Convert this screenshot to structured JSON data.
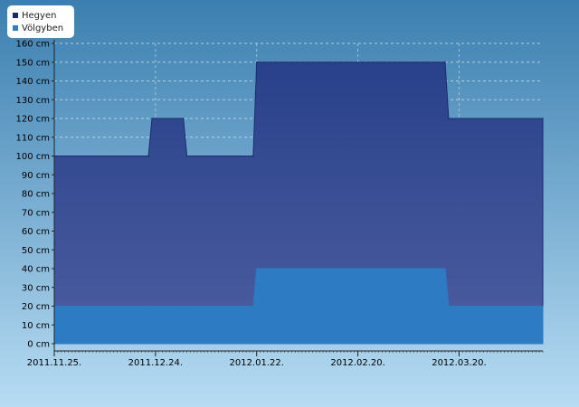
{
  "chart_data": {
    "type": "area",
    "x": [
      "2011-11-25",
      "2011-12-22",
      "2011-12-23",
      "2012-01-01",
      "2012-01-02",
      "2012-01-21",
      "2012-01-22",
      "2012-03-16",
      "2012-03-17",
      "2012-04-13"
    ],
    "series": [
      {
        "name": "Hegyen",
        "color": "#2b3f87",
        "values": [
          100,
          100,
          120,
          120,
          100,
          100,
          150,
          150,
          120,
          120
        ]
      },
      {
        "name": "Völgyben",
        "color": "#2d7fc6",
        "values": [
          20,
          20,
          20,
          20,
          20,
          20,
          40,
          40,
          20,
          20
        ]
      }
    ],
    "x_ticks": [
      "2011.11.25.",
      "2011.12.24.",
      "2012.01.22.",
      "2012.02.20.",
      "2012.03.20."
    ],
    "y_ticks": [
      "0 cm",
      "10 cm",
      "20 cm",
      "30 cm",
      "40 cm",
      "50 cm",
      "60 cm",
      "70 cm",
      "80 cm",
      "90 cm",
      "100 cm",
      "110 cm",
      "120 cm",
      "130 cm",
      "140 cm",
      "150 cm",
      "160 cm"
    ],
    "ylim": [
      0,
      160
    ],
    "xlim": [
      "2011-11-25",
      "2012-04-13"
    ],
    "grid": true,
    "legend_position": "top-left"
  },
  "colors": {
    "bg_top": "#3b7fb0",
    "bg_bottom": "#b7dcf3",
    "hegyen_top": "#28418a",
    "hegyen_bottom": "#4d5da0",
    "volgyben": "#2d7bc2"
  }
}
